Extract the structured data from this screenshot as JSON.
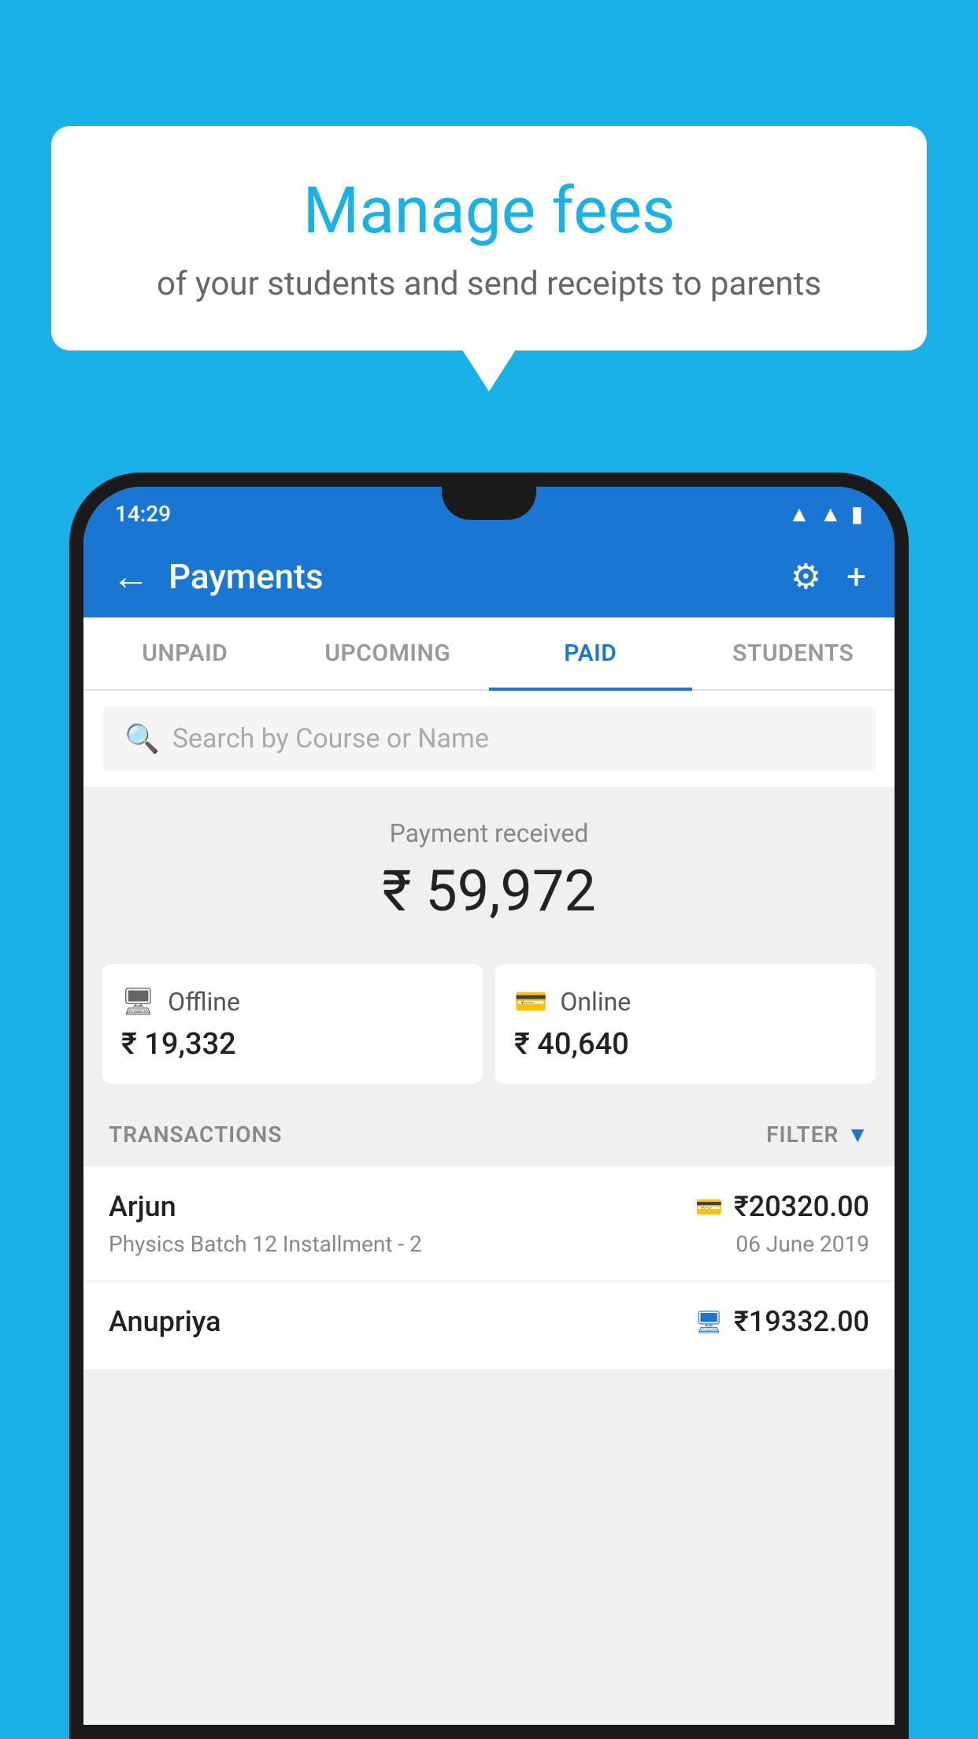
{
  "background_color": "#1ab0e8",
  "speech_bubble": {
    "title": "Manage fees",
    "subtitle": "of your students and send receipts to parents"
  },
  "status_bar": {
    "time": "14:29",
    "wifi_icon": "wifi",
    "signal_icon": "signal",
    "battery_icon": "battery"
  },
  "app_bar": {
    "title": "Payments",
    "back_icon": "←",
    "settings_icon": "⚙",
    "add_icon": "+"
  },
  "tabs": [
    {
      "label": "UNPAID",
      "active": false
    },
    {
      "label": "UPCOMING",
      "active": false
    },
    {
      "label": "PAID",
      "active": true
    },
    {
      "label": "STUDENTS",
      "active": false
    }
  ],
  "search": {
    "placeholder": "Search by Course or Name"
  },
  "payment_received": {
    "label": "Payment received",
    "amount": "₹ 59,972"
  },
  "payment_cards": {
    "offline": {
      "label": "Offline",
      "amount": "₹ 19,332",
      "icon": "💳"
    },
    "online": {
      "label": "Online",
      "amount": "₹ 40,640",
      "icon": "💳"
    }
  },
  "transactions_label": "TRANSACTIONS",
  "filter_label": "FILTER",
  "transactions": [
    {
      "name": "Arjun",
      "details": "Physics Batch 12 Installment - 2",
      "amount": "₹20320.00",
      "date": "06 June 2019",
      "payment_type": "online"
    },
    {
      "name": "Anupriya",
      "details": "",
      "amount": "₹19332.00",
      "date": "",
      "payment_type": "offline"
    }
  ]
}
